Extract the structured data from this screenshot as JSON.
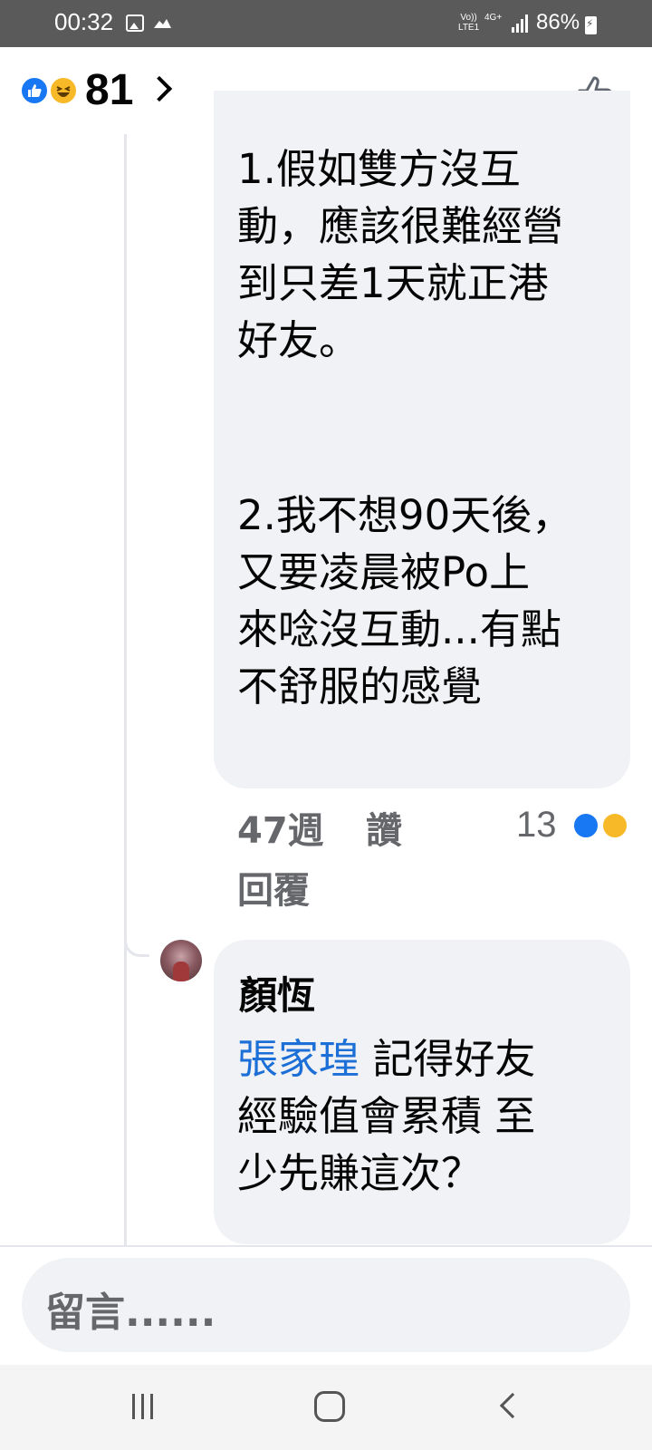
{
  "status_bar": {
    "time": "00:32",
    "volte_line1": "Vo))",
    "volte_line2": "LTE1",
    "network": "4G+",
    "battery": "86%"
  },
  "header": {
    "reaction_count": "81",
    "reaction_icons": [
      "like-icon",
      "haha-icon"
    ]
  },
  "comment_1": {
    "text_lines_1": [
      "1.假如雙方沒互",
      "動，應該很難經營",
      "到只差1天就正港",
      "好友。"
    ],
    "text_lines_2": [
      "2.我不想90天後，",
      "又要凌晨被Po上",
      "來唸沒互動...有點",
      "不舒服的感覺"
    ],
    "time": "47週",
    "like_label": "讚",
    "reply_label": "回覆",
    "reaction_count": "13"
  },
  "comment_2": {
    "author": "顏恆",
    "mention": "張家瑝",
    "text_line1_rest": " 記得好友",
    "text_line2": "經驗值會累積 至",
    "text_line3": "少先賺這次？"
  },
  "composer": {
    "placeholder": "留言......"
  },
  "colors": {
    "accent": "#1877f2",
    "haha": "#f7b928",
    "mention": "#1c6fd6",
    "bubble": "#f0f2f5",
    "meta_text": "#65676b"
  }
}
